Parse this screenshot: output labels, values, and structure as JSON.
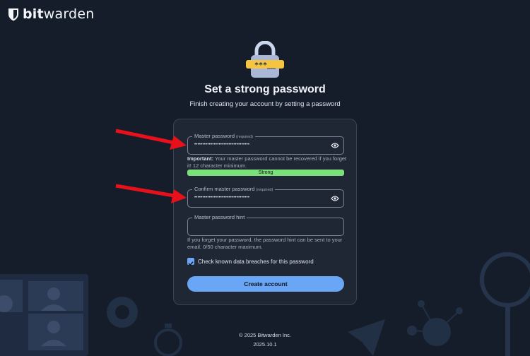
{
  "brand": {
    "name_bold": "bit",
    "name_rest": "warden"
  },
  "page": {
    "title": "Set a strong password",
    "subtitle": "Finish creating your account by setting a password"
  },
  "lock_illustration": {
    "masked": "***__"
  },
  "form": {
    "master_password": {
      "label": "Master password",
      "required": "(required)",
      "value": "••••••••••••••••••••••••••••••••••"
    },
    "helper_important": "Important:",
    "helper_text": " Your master password cannot be recovered if you forget it! 12 character minimum.",
    "strength": "Strong",
    "confirm_password": {
      "label": "Confirm master password",
      "required": "(required)",
      "value": "••••••••••••••••••••••••••••••••••"
    },
    "hint": {
      "label": "Master password hint",
      "value": ""
    },
    "hint_helper": "If you forget your password, the password hint can be sent to your email. 0/50 character maximum.",
    "breach_check_label": "Check known data breaches for this password",
    "breach_check_checked": true,
    "submit_label": "Create account"
  },
  "footer": {
    "copyright": "© 2025 Bitwarden Inc.",
    "version": "2025.10.1"
  },
  "icons": {
    "logo": "bitwarden-shield-icon",
    "show_password": "eye-icon",
    "checkbox": "checkmark-icon"
  },
  "colors": {
    "background": "#151d2a",
    "card": "#1f2735",
    "primary_button": "#6aa6f6",
    "strength_bar": "#7ce07a",
    "annotation_arrow": "#e8101a"
  }
}
